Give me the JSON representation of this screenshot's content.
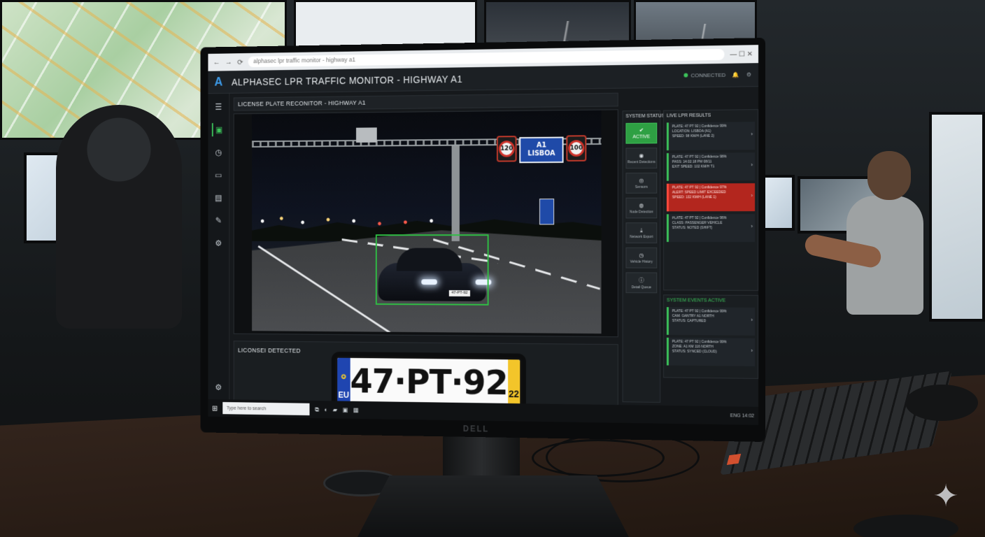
{
  "browser": {
    "url": "alphasec lpr traffic monitor - highway a1",
    "nav_back": "←",
    "nav_forward": "→",
    "nav_reload": "⟳",
    "window_controls": "— ☐ ✕"
  },
  "header": {
    "logo": "A",
    "title": "ALPHASEC LPR TRAFFIC MONITOR - HIGHWAY A1",
    "status_text": "CONNECTED",
    "icons": [
      "bell-icon",
      "user-icon"
    ]
  },
  "sidebar": {
    "icons": [
      "menu-icon",
      "camera-icon",
      "history-icon",
      "monitor-icon",
      "report-icon",
      "tools-icon",
      "settings-icon"
    ]
  },
  "camera_panel": {
    "title": "LICENSE PLATE RECONITOR - HIGHWAY A1",
    "signs": {
      "speed_left": "120",
      "route": "A1",
      "destination": "LISBOA",
      "speed_right": "100"
    },
    "car_plate": "47-PT-92"
  },
  "detected_panel": {
    "label": "LICONSEI DETECTED",
    "plate": {
      "country": "EU",
      "number": "47·PT·92",
      "year": "22"
    }
  },
  "system_status": {
    "title": "SYSTEM STATUS",
    "buttons": [
      {
        "label": "ACTIVE",
        "icon": "check-icon",
        "active": true
      },
      {
        "label": "Recent Detections",
        "icon": "camera-icon",
        "active": false
      },
      {
        "label": "Sensors",
        "icon": "sensor-icon",
        "active": false
      },
      {
        "label": "Node Detection",
        "icon": "radar-icon",
        "active": false
      },
      {
        "label": "Network Export",
        "icon": "download-icon",
        "active": false
      },
      {
        "label": "Vehicle History",
        "icon": "clock-icon",
        "active": false
      },
      {
        "label": "Detail Queue",
        "icon": "info-icon",
        "active": false
      }
    ]
  },
  "live_results": {
    "title": "LIVE LPR RESULTS",
    "items": [
      {
        "line1": "PLATE: 47 PT 92 | Confidence 99%",
        "line2": "LOCATION: LISBOA (A1)",
        "line3": "SPEED: 98 KM/H (LANE 2)",
        "alert": false
      },
      {
        "line1": "PLATE: 47 PT 92 | Confidence 98%",
        "line2": "PASS: 14:02:18 PM 08/11",
        "line3": "EXIT SPEED: 102 KM/H T1",
        "alert": false
      },
      {
        "line1": "PLATE: 47 PT 92 | Confidence 97%",
        "line2": "ALERT: SPEED LIMIT EXCEEDED",
        "line3": "SPEED: 132 KM/H (LANE 1)",
        "alert": true
      },
      {
        "line1": "PLATE: 47 PT 92 | Confidence 96%",
        "line2": "CLASS: PASSENGER VEHICLE",
        "line3": "STATUS: NOTED (SHIFT)",
        "alert": false
      }
    ]
  },
  "system_events": {
    "title": "SYSTEM EVENTS",
    "status": "ACTIVE",
    "items": [
      {
        "line1": "PLATE: 47 PT 92 | Confidence 99%",
        "line2": "CAM: GANTRY A1 NORTH",
        "line3": "STATUS: CAPTURED",
        "alert": false
      },
      {
        "line1": "PLATE: 47 PT 92 | Confidence 99%",
        "line2": "ZONE: A1 KM 116 NORTH",
        "line3": "STATUS: SYNCED (CLOUD)",
        "alert": false
      }
    ]
  },
  "taskbar": {
    "start": "⊞",
    "search_placeholder": "Type here to search",
    "pinned": [
      "task-view-icon",
      "edge-icon",
      "folder-icon",
      "store-icon",
      "app-icon"
    ],
    "tray": "ENG 14:02"
  },
  "monitor_brand": "DELL",
  "colors": {
    "accent_green": "#2ea043",
    "alert_red": "#b3261e",
    "brand_blue": "#3d9be9",
    "bbox_green": "#2fbf44"
  }
}
